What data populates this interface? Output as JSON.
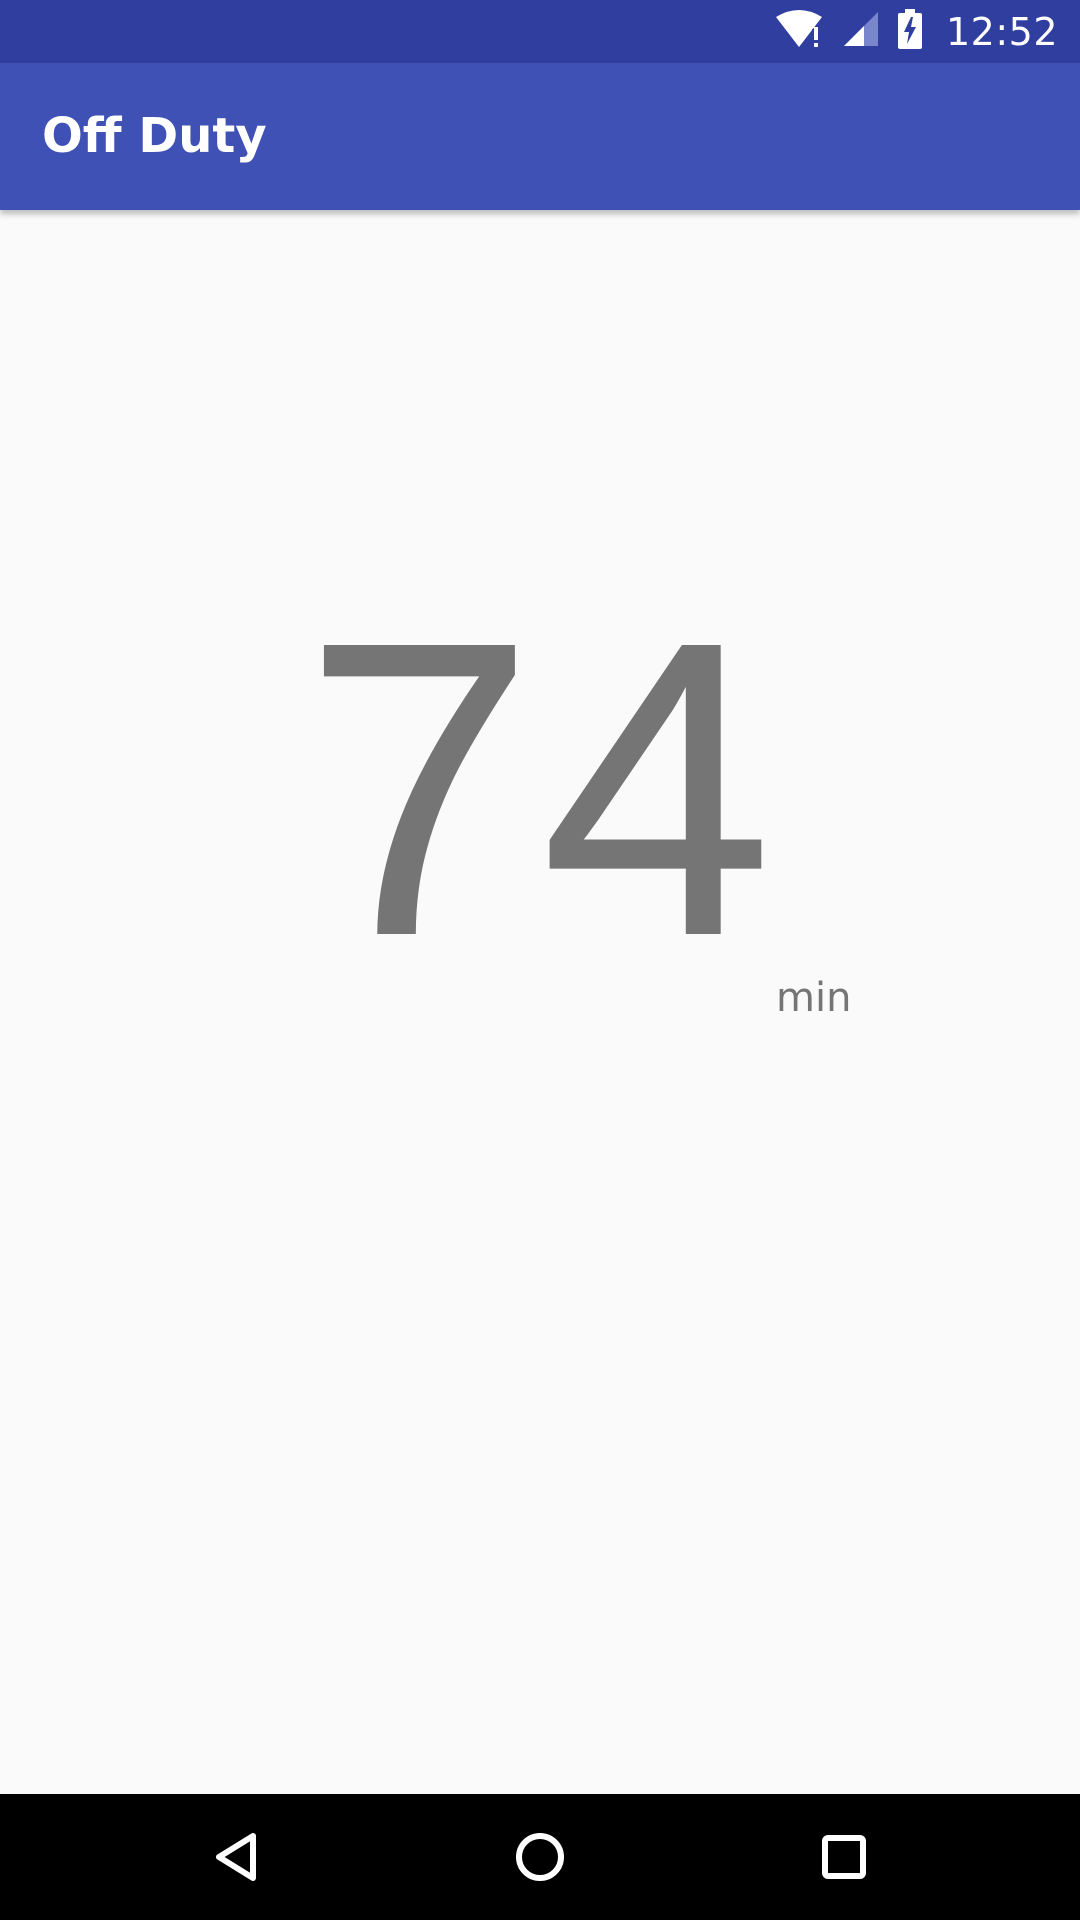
{
  "status_bar": {
    "time": "12:52",
    "icons": [
      "wifi-alert-icon",
      "cell-signal-icon",
      "battery-charging-icon"
    ],
    "color": "#303f9f"
  },
  "app_bar": {
    "title": "Off Duty",
    "color": "#3f51b5"
  },
  "main": {
    "value": "74",
    "unit": "min",
    "text_color": "#757575"
  },
  "nav_bar": {
    "buttons": [
      "back-icon",
      "home-icon",
      "recents-icon"
    ]
  }
}
